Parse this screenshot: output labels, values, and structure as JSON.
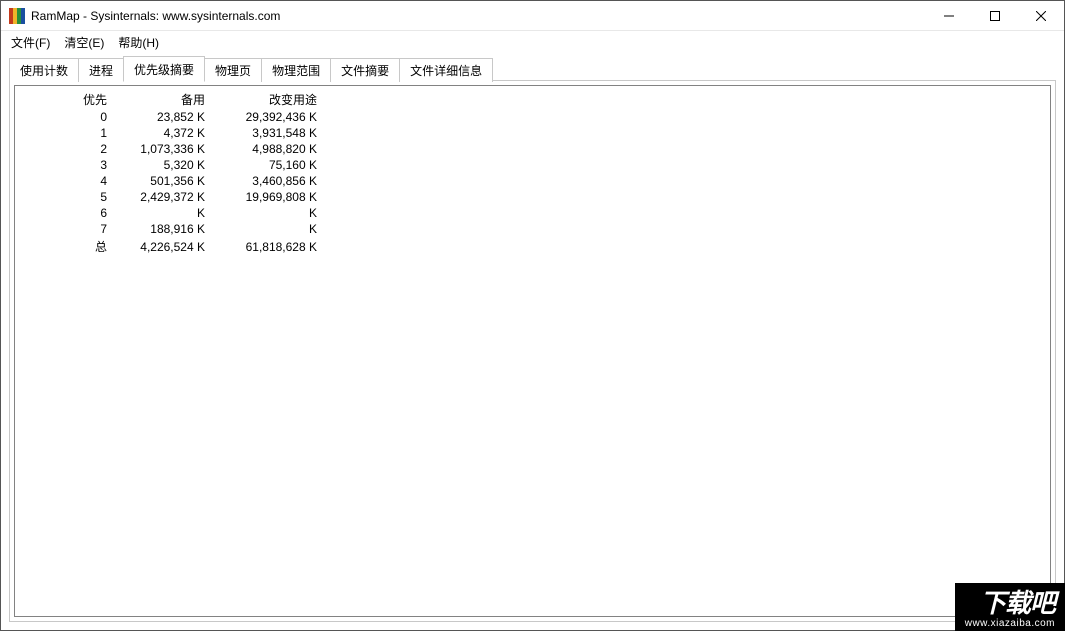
{
  "title": "RamMap - Sysinternals: www.sysinternals.com",
  "menu": {
    "file": "文件(F)",
    "empty": "清空(E)",
    "help": "帮助(H)"
  },
  "tabs": {
    "use_counts": "使用计数",
    "processes": "进程",
    "priority_summary": "优先级摘要",
    "physical_pages": "物理页",
    "physical_ranges": "物理范围",
    "file_summary": "文件摘要",
    "file_details": "文件详细信息",
    "active": "priority_summary"
  },
  "table": {
    "headers": {
      "priority": "优先",
      "standby": "备用",
      "repurposed": "改变用途"
    },
    "rows": [
      {
        "priority": "0",
        "standby": "23,852 K",
        "repurposed": "29,392,436 K"
      },
      {
        "priority": "1",
        "standby": "4,372 K",
        "repurposed": "3,931,548 K"
      },
      {
        "priority": "2",
        "standby": "1,073,336 K",
        "repurposed": "4,988,820 K"
      },
      {
        "priority": "3",
        "standby": "5,320 K",
        "repurposed": "75,160 K"
      },
      {
        "priority": "4",
        "standby": "501,356 K",
        "repurposed": "3,460,856 K"
      },
      {
        "priority": "5",
        "standby": "2,429,372 K",
        "repurposed": "19,969,808 K"
      },
      {
        "priority": "6",
        "standby": "K",
        "repurposed": "K"
      },
      {
        "priority": "7",
        "standby": "188,916 K",
        "repurposed": "K"
      },
      {
        "priority": "总",
        "standby": "4,226,524 K",
        "repurposed": "61,818,628 K"
      }
    ]
  },
  "watermark": {
    "name": "下载吧",
    "url": "www.xiazaiba.com"
  }
}
